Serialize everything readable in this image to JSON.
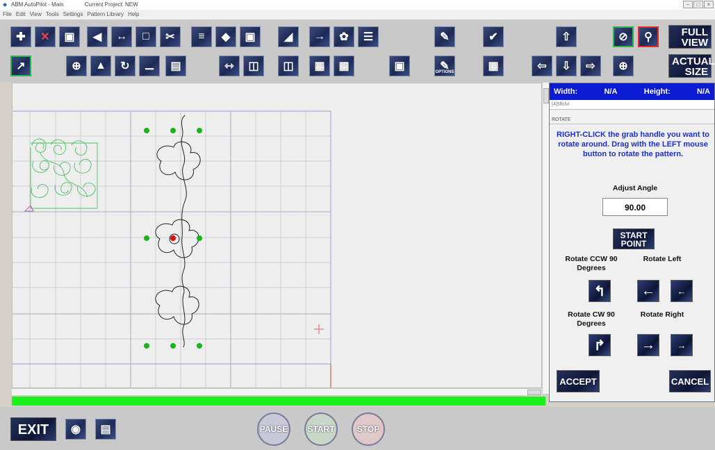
{
  "window": {
    "title": "ABM AutoPilot - Main",
    "project": "Current Project: NEW",
    "controls": [
      "−",
      "□",
      "×"
    ]
  },
  "menu": [
    "File",
    "Edit",
    "View",
    "Tools",
    "Settings",
    "Pattern Library",
    "Help"
  ],
  "toolbar": {
    "full_view": "FULL VIEW",
    "actual_size": "ACTUAL SIZE",
    "options_label": "OPTIONS"
  },
  "info": {
    "width_label": "Width:",
    "width_value": "N/A",
    "height_label": "Height:",
    "height_value": "N/A",
    "field_text": "[4]5lfclvi"
  },
  "rotate": {
    "section": "ROTATE",
    "instructions": "RIGHT-CLICK the grab handle you want to rotate around. Drag with the LEFT mouse button to rotate the pattern.",
    "adjust_label": "Adjust Angle",
    "angle_value": "90.00",
    "start_point": "START POINT",
    "ccw_label": "Rotate CCW 90 Degrees",
    "left_label": "Rotate Left",
    "cw_label": "Rotate CW 90 Degrees",
    "right_label": "Rotate Right",
    "accept": "ACCEPT",
    "cancel": "CANCEL"
  },
  "bottom": {
    "exit": "EXIT",
    "pause": "PAUSE",
    "start": "START",
    "stop": "STOP"
  },
  "colors": {
    "progress": "#1cf01c",
    "panel_header": "#0a1bd3",
    "instruction_text": "#1a2fd9",
    "handle_green": "#1ab41a",
    "handle_red": "#e01010"
  }
}
